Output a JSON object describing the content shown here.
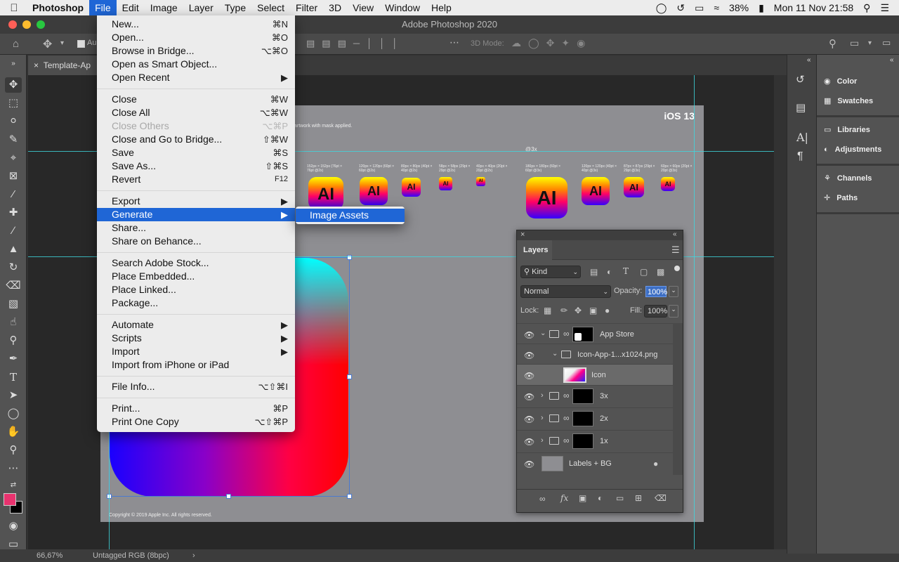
{
  "menubar": {
    "app_name": "Photoshop",
    "items": [
      "File",
      "Edit",
      "Image",
      "Layer",
      "Type",
      "Select",
      "Filter",
      "3D",
      "View",
      "Window",
      "Help"
    ],
    "battery": "38%",
    "datetime": "Mon 11 Nov  21:58"
  },
  "window": {
    "title": "Adobe Photoshop 2020"
  },
  "document": {
    "tab_title": "Template-Ap",
    "zoom": "66,67%",
    "color_profile": "Untagged RGB (8bpc)"
  },
  "options_bar": {
    "auto_select_label": "Au",
    "mode_3d_label": "3D Mode:"
  },
  "file_menu": {
    "items": [
      {
        "label": "New...",
        "shortcut": "⌘N"
      },
      {
        "label": "Open...",
        "shortcut": "⌘O"
      },
      {
        "label": "Browse in Bridge...",
        "shortcut": "⌥⌘O"
      },
      {
        "label": "Open as Smart Object...",
        "shortcut": ""
      },
      {
        "label": "Open Recent",
        "shortcut": "▶"
      },
      {
        "label": "Close",
        "shortcut": "⌘W"
      },
      {
        "label": "Close All",
        "shortcut": "⌥⌘W"
      },
      {
        "label": "Close Others",
        "shortcut": "⌥⌘P"
      },
      {
        "label": "Close and Go to Bridge...",
        "shortcut": "⇧⌘W"
      },
      {
        "label": "Save",
        "shortcut": "⌘S"
      },
      {
        "label": "Save As...",
        "shortcut": "⇧⌘S"
      },
      {
        "label": "Revert",
        "shortcut": "F12"
      },
      {
        "label": "Export",
        "shortcut": "▶"
      },
      {
        "label": "Generate",
        "shortcut": "▶"
      },
      {
        "label": "Share...",
        "shortcut": ""
      },
      {
        "label": "Share on Behance...",
        "shortcut": ""
      },
      {
        "label": "Search Adobe Stock...",
        "shortcut": ""
      },
      {
        "label": "Place Embedded...",
        "shortcut": ""
      },
      {
        "label": "Place Linked...",
        "shortcut": ""
      },
      {
        "label": "Package...",
        "shortcut": ""
      },
      {
        "label": "Automate",
        "shortcut": "▶"
      },
      {
        "label": "Scripts",
        "shortcut": "▶"
      },
      {
        "label": "Import",
        "shortcut": "▶"
      },
      {
        "label": "Import from iPhone or iPad",
        "shortcut": ""
      },
      {
        "label": "File Info...",
        "shortcut": "⌥⇧⌘I"
      },
      {
        "label": "Print...",
        "shortcut": "⌘P"
      },
      {
        "label": "Print One Copy",
        "shortcut": "⌥⇧⌘P"
      }
    ]
  },
  "generate_submenu": {
    "items": [
      "Image Assets"
    ]
  },
  "artboard": {
    "header_title": "iOS 13",
    "note": "artwork with mask applied.",
    "scale_label": "@3x",
    "copyright": "Copyright © 2019 Apple Inc. All rights reserved.",
    "icon_text": "AI",
    "size_labels_2x": [
      "152px × 152px (76pt × 76pt @2x)",
      "120px × 120px (60pt × 60pt @2x)",
      "80px × 80px (40pt × 40pt @2x)",
      "58px × 58px (29pt × 29pt @2x)",
      "40px × 40px (20pt × 20pt @2x)"
    ],
    "size_labels_3x": [
      "180px × 180px (60pt × 60pt @3x)",
      "120px × 120px (40pt × 40pt @3x)",
      "87px × 87px (29pt × 29pt @3x)",
      "60px × 60px (20pt × 20pt @3x)"
    ]
  },
  "right_panel": {
    "groups": [
      [
        "Color",
        "Swatches"
      ],
      [
        "Libraries",
        "Adjustments"
      ],
      [
        "Channels",
        "Paths"
      ]
    ]
  },
  "layers_panel": {
    "tab": "Layers",
    "kind_label": "Kind",
    "blend_mode": "Normal",
    "opacity_label": "Opacity:",
    "opacity_value": "100%",
    "lock_label": "Lock:",
    "fill_label": "Fill:",
    "fill_value": "100%",
    "layers": [
      {
        "name": "App Store"
      },
      {
        "name": "Icon-App-1...x1024.png"
      },
      {
        "name": "Icon"
      },
      {
        "name": "3x"
      },
      {
        "name": "2x"
      },
      {
        "name": "1x"
      },
      {
        "name": "Labels + BG"
      }
    ]
  },
  "colors": {
    "accent": "#1f66d6",
    "guide": "#3fd8e0",
    "foreground": "#e8326e",
    "background": "#000000"
  }
}
